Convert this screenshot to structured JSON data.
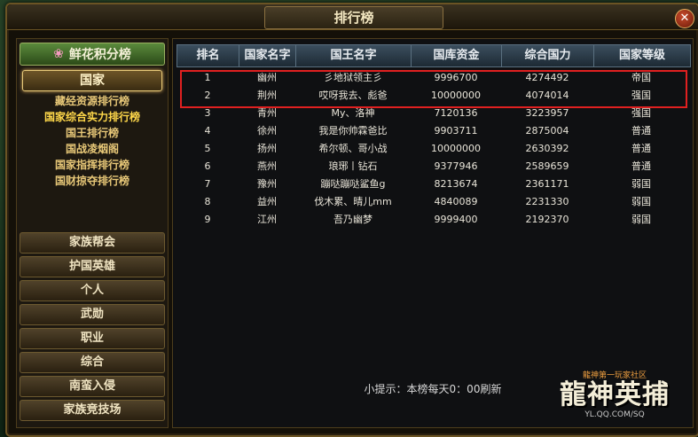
{
  "window": {
    "title": "排行榜",
    "close_symbol": "✕"
  },
  "left": {
    "flower_button": "鲜花积分榜",
    "flower_icon": "❀",
    "country_button": "国家",
    "sub_items": [
      "藏经资源排行榜",
      "国家综合实力排行榜",
      "国王排行榜",
      "国战凌烟阁",
      "国家指挥排行榜",
      "国财掠夺排行榜"
    ],
    "active_sub_index": 1,
    "categories": [
      "家族帮会",
      "护国英雄",
      "个人",
      "武勋",
      "职业",
      "综合",
      "南蛮入侵",
      "家族竞技场"
    ]
  },
  "table": {
    "headers": [
      "排名",
      "国家名字",
      "国王名字",
      "国库资金",
      "综合国力",
      "国家等级"
    ],
    "rows": [
      [
        "1",
        "幽州",
        "彡地狱领主彡",
        "9996700",
        "4274492",
        "帝国"
      ],
      [
        "2",
        "荆州",
        "哎呀我去、彪爸",
        "10000000",
        "4074014",
        "强国"
      ],
      [
        "3",
        "青州",
        "My、洛神",
        "7120136",
        "3223957",
        "强国"
      ],
      [
        "4",
        "徐州",
        "我是你帅霖爸比",
        "9903711",
        "2875004",
        "普通"
      ],
      [
        "5",
        "扬州",
        "希尔顿、哥小战",
        "10000000",
        "2630392",
        "普通"
      ],
      [
        "6",
        "燕州",
        "琅琊丨钻石",
        "9377946",
        "2589659",
        "普通"
      ],
      [
        "7",
        "豫州",
        "蹦哒蹦哒鲨鱼g",
        "8213674",
        "2361171",
        "弱国"
      ],
      [
        "8",
        "益州",
        "伐木累、晴儿mm",
        "4840089",
        "2231330",
        "弱国"
      ],
      [
        "9",
        "江州",
        "吾乃幽梦",
        "9999400",
        "2192370",
        "弱国"
      ]
    ]
  },
  "hint": "小提示：本榜每天0：00刷新",
  "logo": {
    "top": "龍神第一玩家社区",
    "main": "龍神英捕",
    "url": "YL.QQ.COM/SQ"
  }
}
